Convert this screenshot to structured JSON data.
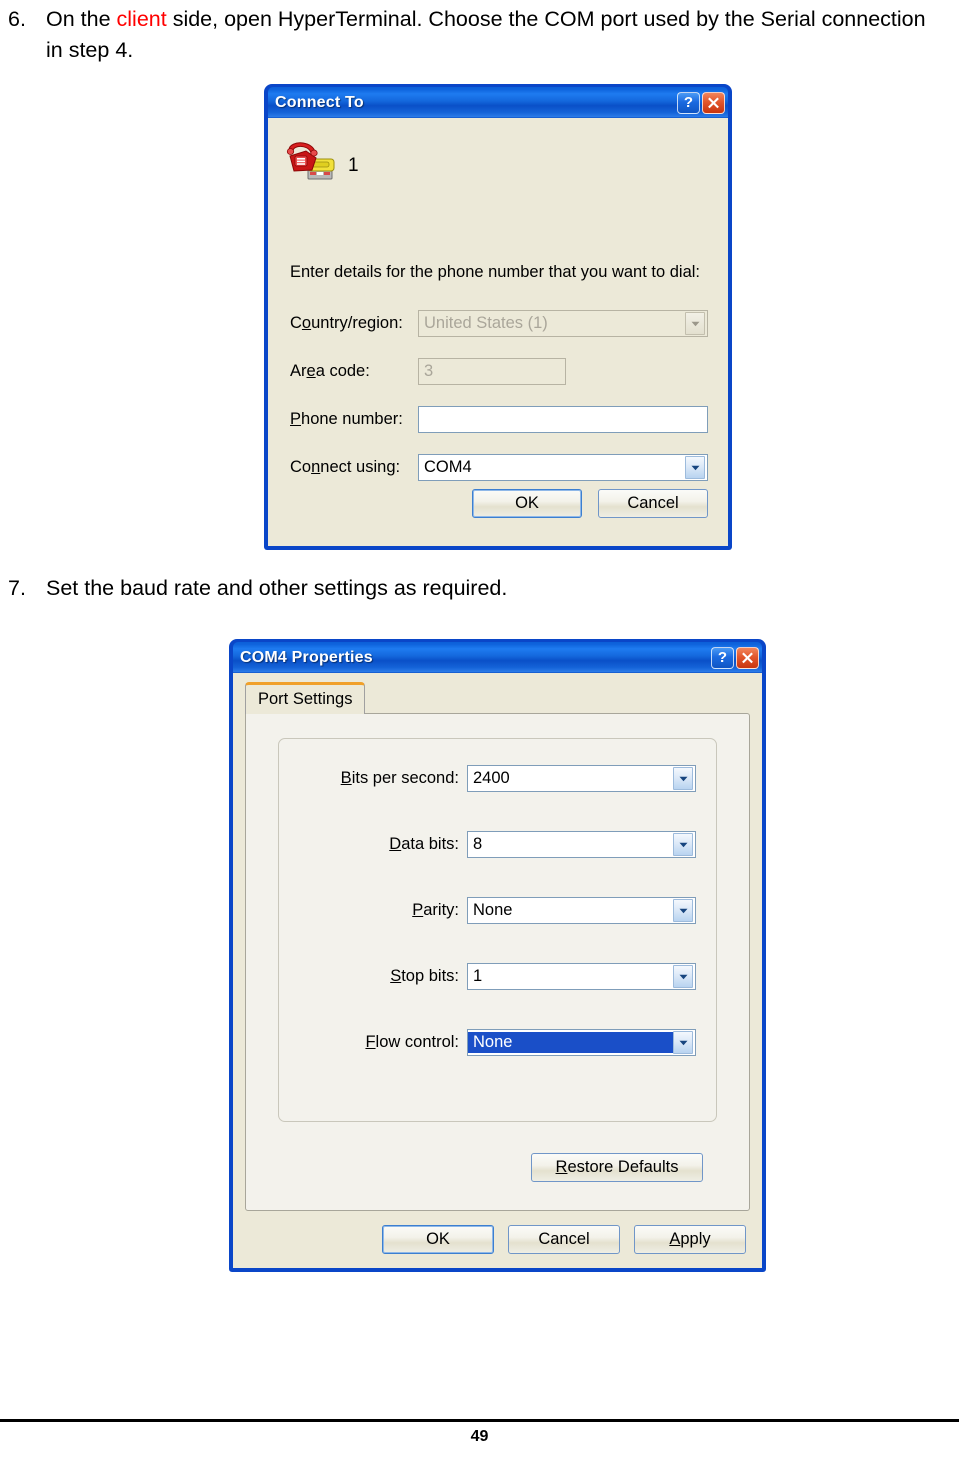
{
  "document": {
    "steps": [
      {
        "number": "6.",
        "text_before": "On the ",
        "highlight": "client",
        "text_after": " side, open HyperTerminal. Choose the COM port used by the Serial connection in step 4.",
        "highlight_color": "#ff0000"
      },
      {
        "number": "7.",
        "text": "Set the baud rate and other settings as required."
      }
    ],
    "footer": {
      "page_number": "49"
    }
  },
  "dialog_connect_to": {
    "title": "Connect To",
    "titlebar_buttons": {
      "help": "?",
      "close": "✕"
    },
    "connection_icon": "phone-modem-icon",
    "connection_name": "1",
    "prompt": "Enter details for the phone number that you want to dial:",
    "fields": [
      {
        "label_pre": "C",
        "label_accel": "o",
        "label_post": "untry/region:",
        "value": "United States (1)",
        "control": "combobox",
        "state": "disabled"
      },
      {
        "label_pre": "Ar",
        "label_accel": "e",
        "label_post": "a code:",
        "value": "3",
        "control": "textbox",
        "state": "disabled"
      },
      {
        "label_pre": "",
        "label_accel": "P",
        "label_post": "hone number:",
        "value": "",
        "control": "textbox",
        "state": "enabled"
      },
      {
        "label_pre": "Co",
        "label_accel": "n",
        "label_post": "nect using:",
        "value": "COM4",
        "control": "combobox",
        "state": "enabled"
      }
    ],
    "buttons": [
      {
        "label": "OK",
        "default": true
      },
      {
        "label": "Cancel",
        "default": false
      }
    ]
  },
  "dialog_com4_properties": {
    "title": "COM4 Properties",
    "titlebar_buttons": {
      "help": "?",
      "close": "✕"
    },
    "tabs": [
      {
        "label": "Port Settings",
        "active": true
      }
    ],
    "fields": [
      {
        "label_pre": "",
        "label_accel": "B",
        "label_post": "its per second:",
        "value": "2400",
        "control": "combobox",
        "state": "enabled"
      },
      {
        "label_pre": "",
        "label_accel": "D",
        "label_post": "ata bits:",
        "value": "8",
        "control": "combobox",
        "state": "enabled"
      },
      {
        "label_pre": "",
        "label_accel": "P",
        "label_post": "arity:",
        "value": "None",
        "control": "combobox",
        "state": "enabled"
      },
      {
        "label_pre": "",
        "label_accel": "S",
        "label_post": "top bits:",
        "value": "1",
        "control": "combobox",
        "state": "enabled"
      },
      {
        "label_pre": "",
        "label_accel": "F",
        "label_post": "low control:",
        "value": "None",
        "control": "combobox",
        "state": "focused"
      }
    ],
    "restore_button": {
      "label_pre": "",
      "label_accel": "R",
      "label_post": "estore Defaults"
    },
    "buttons": [
      {
        "label_pre": "",
        "label_accel": "",
        "label_post": "OK",
        "default": true
      },
      {
        "label_pre": "",
        "label_accel": "",
        "label_post": "Cancel",
        "default": false
      },
      {
        "label_pre": "",
        "label_accel": "A",
        "label_post": "pply",
        "default": false
      }
    ]
  },
  "colors": {
    "titlebar_blue": "#0a50c8",
    "dialog_face": "#ece9d8",
    "tab_accent_orange": "#f0a02a",
    "selection_blue": "#1a4fc8",
    "close_red": "#e2562c",
    "highlight_red": "#ff0000"
  }
}
